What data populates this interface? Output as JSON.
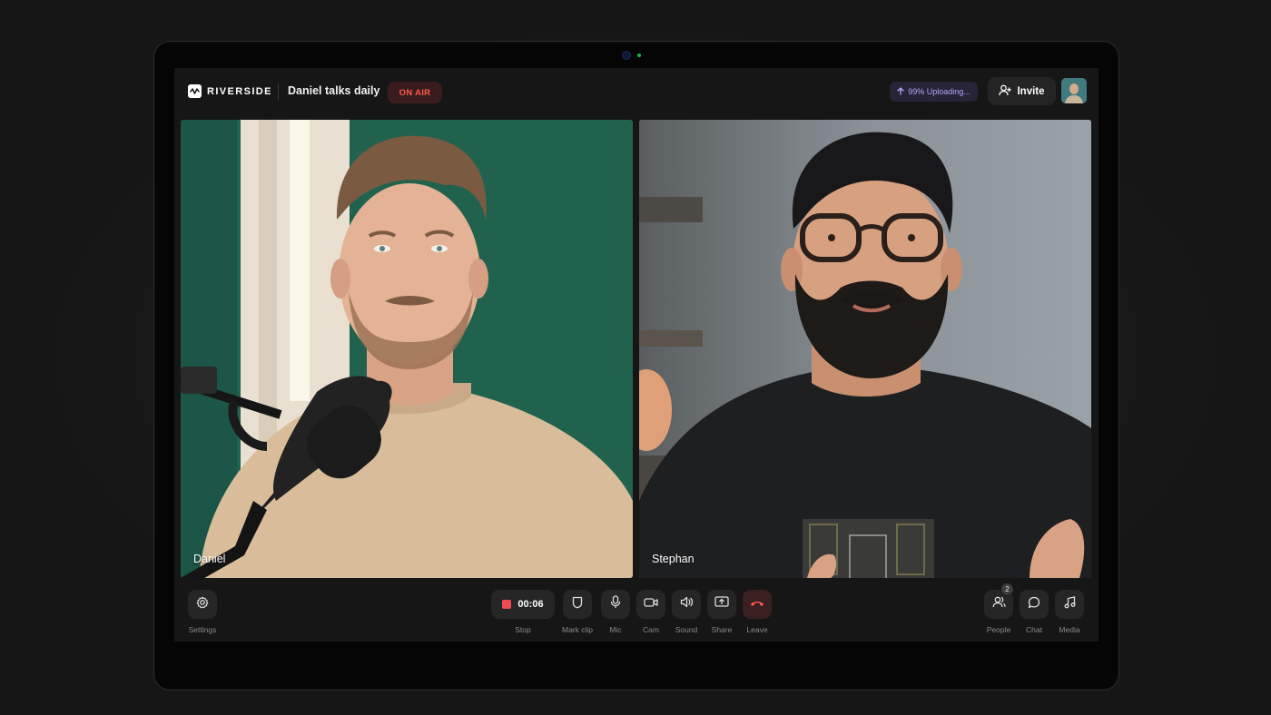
{
  "app": {
    "brand": "RIVERSIDE",
    "show_title": "Daniel talks daily",
    "status_badge": "ON AIR",
    "upload_status": "99% Uploading...",
    "invite_label": "Invite"
  },
  "participants": [
    {
      "name": "Daniel"
    },
    {
      "name": "Stephan"
    }
  ],
  "controls": {
    "settings": "Settings",
    "timer": "00:06",
    "stop": "Stop",
    "mark_clip": "Mark clip",
    "mic": "Mic",
    "cam": "Cam",
    "sound": "Sound",
    "share": "Share",
    "leave": "Leave",
    "people": "People",
    "people_count": "2",
    "chat": "Chat",
    "media": "Media"
  },
  "colors": {
    "on_air": "#ff5a4e",
    "record": "#ef4b55",
    "upload_accent": "#b7a7ff",
    "leave": "#ff5a4e"
  }
}
